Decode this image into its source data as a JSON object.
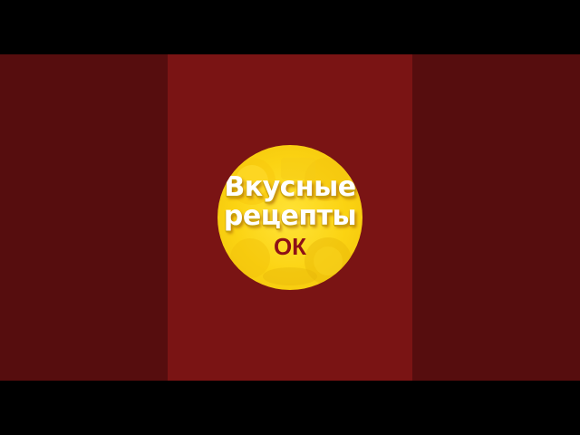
{
  "colors": {
    "letterbox": "#000000",
    "pillar": "#560d0e",
    "center_panel": "#7a1414",
    "logo_yellow": "#fbd312",
    "logo_text_white": "#ffffff",
    "logo_text_red": "#8e1116"
  },
  "logo": {
    "line1": "Вкусные",
    "line2": "рецепты",
    "line3": "ОК"
  }
}
